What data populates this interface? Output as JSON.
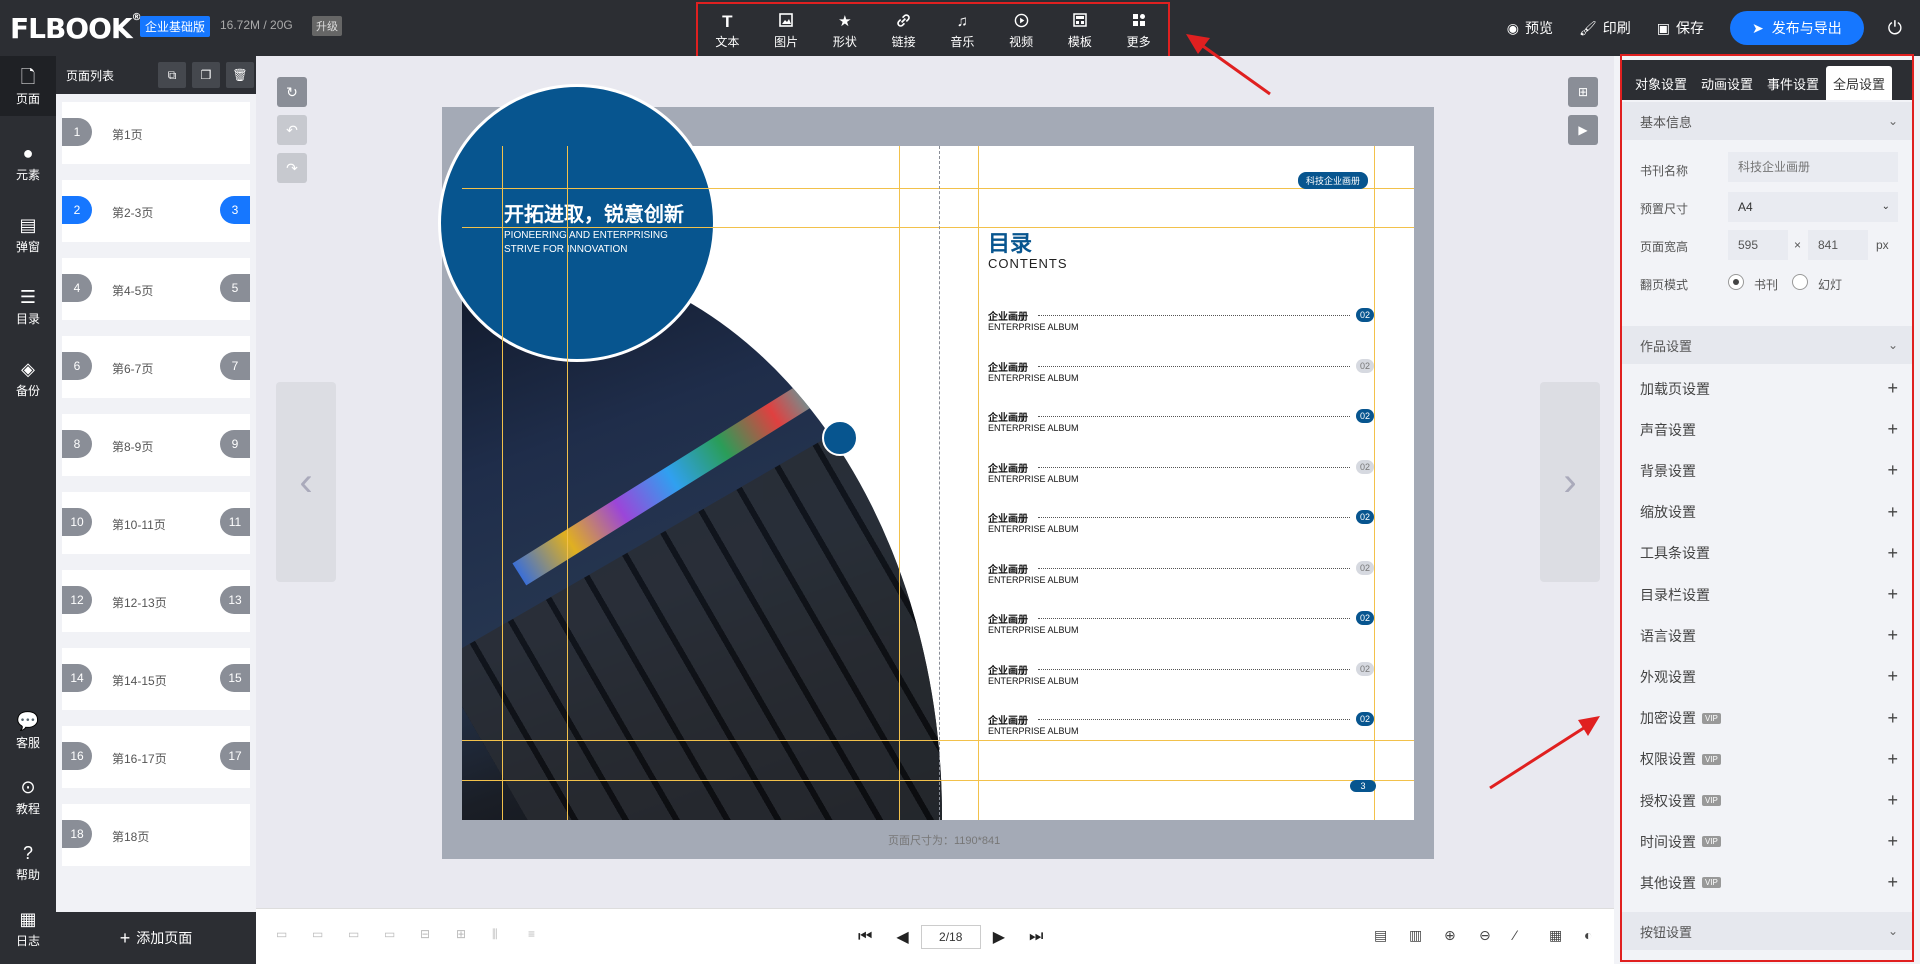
{
  "header": {
    "logo": "FLBOOK",
    "logo_mark": "®",
    "edition": "企业基础版",
    "storage": "16.72M / 20G",
    "upgrade": "升级",
    "tools": [
      {
        "label": "文本",
        "icon": "text-icon"
      },
      {
        "label": "图片",
        "icon": "image-icon"
      },
      {
        "label": "形状",
        "icon": "star-icon"
      },
      {
        "label": "链接",
        "icon": "link-icon"
      },
      {
        "label": "音乐",
        "icon": "music-icon"
      },
      {
        "label": "视频",
        "icon": "video-icon"
      },
      {
        "label": "模板",
        "icon": "template-icon"
      },
      {
        "label": "更多",
        "icon": "more-icon"
      }
    ],
    "preview": "预览",
    "print": "印刷",
    "save": "保存",
    "publish": "发布与导出"
  },
  "leftnav": {
    "items": [
      {
        "label": "页面",
        "icon": "page-icon"
      },
      {
        "label": "元素",
        "icon": "elements-icon"
      },
      {
        "label": "弹窗",
        "icon": "popup-icon"
      },
      {
        "label": "目录",
        "icon": "list-icon"
      },
      {
        "label": "备份",
        "icon": "layers-icon"
      }
    ],
    "bottom": [
      {
        "label": "客服",
        "icon": "chat-icon"
      },
      {
        "label": "教程",
        "icon": "play-icon"
      },
      {
        "label": "帮助",
        "icon": "help-icon"
      },
      {
        "label": "日志",
        "icon": "log-icon"
      }
    ]
  },
  "pages": {
    "title": "页面列表",
    "add": "添加页面",
    "items": [
      {
        "label": "第1页",
        "left": "1",
        "right": ""
      },
      {
        "label": "第2-3页",
        "left": "2",
        "right": "3",
        "active": true
      },
      {
        "label": "第4-5页",
        "left": "4",
        "right": "5"
      },
      {
        "label": "第6-7页",
        "left": "6",
        "right": "7"
      },
      {
        "label": "第8-9页",
        "left": "8",
        "right": "9"
      },
      {
        "label": "第10-11页",
        "left": "10",
        "right": "11"
      },
      {
        "label": "第12-13页",
        "left": "12",
        "right": "13"
      },
      {
        "label": "第14-15页",
        "left": "14",
        "right": "15"
      },
      {
        "label": "第16-17页",
        "left": "16",
        "right": "17"
      },
      {
        "label": "第18页",
        "left": "18",
        "right": ""
      }
    ]
  },
  "book": {
    "circle_title": "开拓进取，锐意创新",
    "circle_sub1": "PIONEERING AND ENTERPRISING",
    "circle_sub2": "STRIVE FOR INNOVATION",
    "badge": "科技企业画册",
    "toc_title": "目录",
    "toc_en": "CONTENTS",
    "toc_items": [
      {
        "zh": "企业画册",
        "en": "ENTERPRISE ALBUM",
        "num": "02",
        "light": false
      },
      {
        "zh": "企业画册",
        "en": "ENTERPRISE ALBUM",
        "num": "02",
        "light": true
      },
      {
        "zh": "企业画册",
        "en": "ENTERPRISE ALBUM",
        "num": "02",
        "light": false
      },
      {
        "zh": "企业画册",
        "en": "ENTERPRISE ALBUM",
        "num": "02",
        "light": true
      },
      {
        "zh": "企业画册",
        "en": "ENTERPRISE ALBUM",
        "num": "02",
        "light": false
      },
      {
        "zh": "企业画册",
        "en": "ENTERPRISE ALBUM",
        "num": "02",
        "light": true
      },
      {
        "zh": "企业画册",
        "en": "ENTERPRISE ALBUM",
        "num": "02",
        "light": false
      },
      {
        "zh": "企业画册",
        "en": "ENTERPRISE ALBUM",
        "num": "02",
        "light": true
      },
      {
        "zh": "企业画册",
        "en": "ENTERPRISE ALBUM",
        "num": "02",
        "light": false
      }
    ],
    "page_number": "3",
    "page_size": "页面尺寸为：1190*841"
  },
  "pager": {
    "value": "2/18"
  },
  "settings": {
    "tabs": [
      "对象设置",
      "动画设置",
      "事件设置",
      "全局设置"
    ],
    "basic_title": "基本信息",
    "book_name_label": "书刊名称",
    "book_name_placeholder": "科技企业画册",
    "preset_label": "预置尺寸",
    "preset_value": "A4",
    "size_label": "页面宽高",
    "width": "595",
    "height": "841",
    "times": "×",
    "unit": "px",
    "flip_label": "翻页模式",
    "flip_book": "书刊",
    "flip_slide": "幻灯",
    "work_title": "作品设置",
    "items": [
      {
        "label": "加载页设置",
        "vip": false
      },
      {
        "label": "声音设置",
        "vip": false
      },
      {
        "label": "背景设置",
        "vip": false
      },
      {
        "label": "缩放设置",
        "vip": false
      },
      {
        "label": "工具条设置",
        "vip": false
      },
      {
        "label": "目录栏设置",
        "vip": false
      },
      {
        "label": "语言设置",
        "vip": false
      },
      {
        "label": "外观设置",
        "vip": false
      },
      {
        "label": "加密设置",
        "vip": true
      },
      {
        "label": "权限设置",
        "vip": true
      },
      {
        "label": "授权设置",
        "vip": true
      },
      {
        "label": "时间设置",
        "vip": true
      },
      {
        "label": "其他设置",
        "vip": true
      }
    ],
    "vip_text": "VIP",
    "button_title": "按钮设置"
  },
  "colors": {
    "accent": "#1677ff",
    "brand_blue": "#07558f",
    "annotation_red": "#e02020",
    "dark": "#2c2e33"
  }
}
